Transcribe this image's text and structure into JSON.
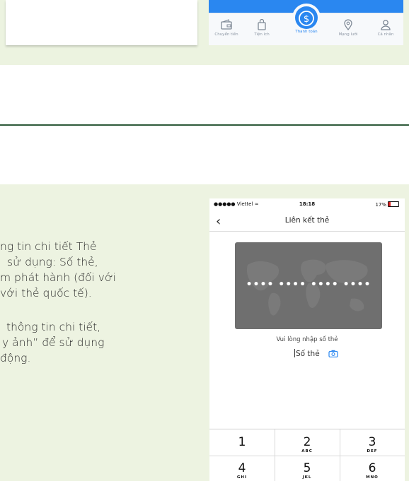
{
  "top_tabbar": {
    "tabs": [
      {
        "label": "Chuyển tiền",
        "icon": "wallet-icon",
        "active": false
      },
      {
        "label": "Tiện ích",
        "icon": "bag-icon",
        "active": false
      },
      {
        "label": "Thanh toán",
        "icon": "dollar-icon",
        "active": true
      },
      {
        "label": "Mạng lưới",
        "icon": "location-pin-icon",
        "active": false
      },
      {
        "label": "Cá nhân",
        "icon": "person-icon",
        "active": false
      }
    ],
    "accent_color": "#2a87f0"
  },
  "article_text": {
    "lines": [
      "ng tin chi tiết Thẻ",
      "sử dụng: Số thẻ,",
      "m phát hành (đối với",
      "với thẻ quốc tế).",
      "thông tin chi tiết,",
      "y ảnh” để sử dụng",
      "động."
    ]
  },
  "phone": {
    "status_bar": {
      "carrier": "●●●●● Viettel",
      "time": "18:18",
      "battery": "17%"
    },
    "nav_title": "Liên kết thẻ",
    "card_number_mask": "•••• •••• •••• ••••",
    "hint": "Vui lòng nhập số thẻ",
    "card_field_placeholder": "Số thẻ",
    "keypad": [
      {
        "num": "1",
        "letters": ""
      },
      {
        "num": "2",
        "letters": "ABC"
      },
      {
        "num": "3",
        "letters": "DEF"
      },
      {
        "num": "4",
        "letters": "GHI"
      },
      {
        "num": "5",
        "letters": "JKL"
      },
      {
        "num": "6",
        "letters": "MNO"
      }
    ]
  }
}
